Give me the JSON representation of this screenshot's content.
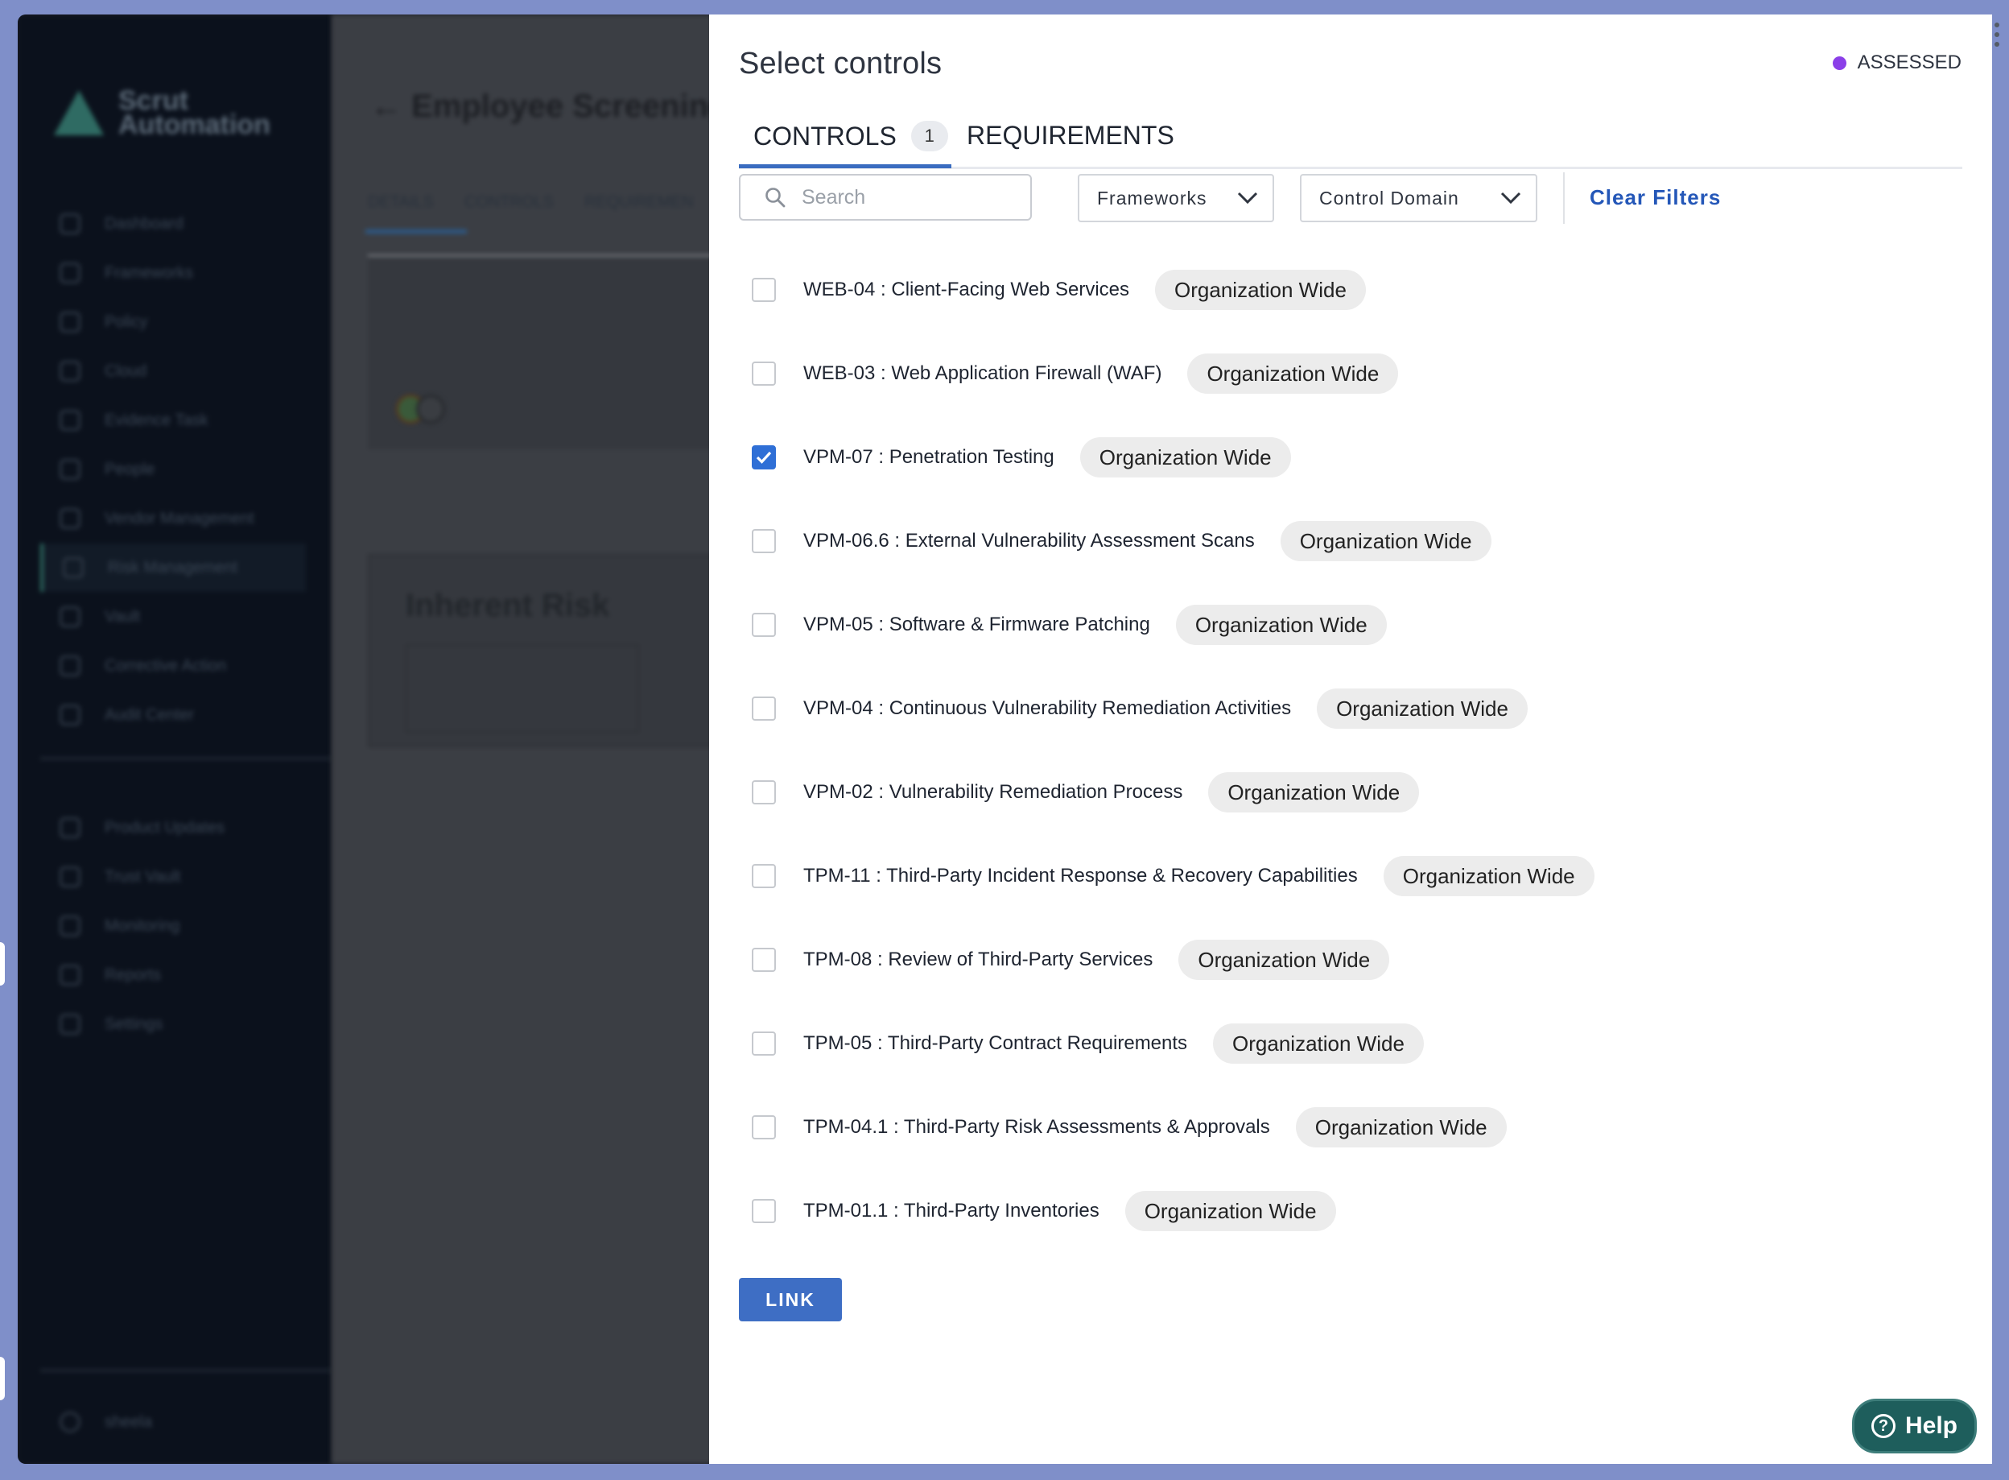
{
  "background": {
    "logo_text": "Scrut Automation",
    "sidebar_items": [
      "Dashboard",
      "Frameworks",
      "Policy",
      "Cloud",
      "Evidence Task",
      "People",
      "Vendor Management",
      "Risk Management",
      "Vault",
      "Corrective Action",
      "Audit Center"
    ],
    "sidebar_items_bottom": [
      "Product Updates",
      "Trust Vault",
      "Monitoring",
      "Reports",
      "Settings"
    ],
    "user_name": "sheela",
    "page_heading": "← Employee Screening - t",
    "tabs": [
      "DETAILS",
      "CONTROLS",
      "REQUIREMEN"
    ],
    "inherent_risk_title": "Inherent Risk"
  },
  "modal": {
    "title": "Select controls",
    "status": {
      "label": "ASSESSED",
      "color": "#8b3fe8"
    },
    "tabs": [
      {
        "label": "CONTROLS",
        "count": "1",
        "active": true
      },
      {
        "label": "REQUIREMENTS",
        "active": false
      }
    ],
    "search": {
      "placeholder": "Search",
      "value": ""
    },
    "filters": {
      "frameworks": "Frameworks",
      "control_domain": "Control Domain",
      "clear": "Clear Filters"
    },
    "controls": [
      {
        "label": "WEB-04 : Client-Facing Web Services",
        "scope": "Organization Wide",
        "checked": false
      },
      {
        "label": "WEB-03 : Web Application Firewall (WAF)",
        "scope": "Organization Wide",
        "checked": false
      },
      {
        "label": "VPM-07 : Penetration Testing",
        "scope": "Organization Wide",
        "checked": true
      },
      {
        "label": "VPM-06.6 : External Vulnerability Assessment Scans",
        "scope": "Organization Wide",
        "checked": false
      },
      {
        "label": "VPM-05 : Software & Firmware Patching",
        "scope": "Organization Wide",
        "checked": false
      },
      {
        "label": "VPM-04 : Continuous Vulnerability Remediation Activities",
        "scope": "Organization Wide",
        "checked": false
      },
      {
        "label": "VPM-02 : Vulnerability Remediation Process",
        "scope": "Organization Wide",
        "checked": false
      },
      {
        "label": "TPM-11 : Third-Party Incident Response & Recovery Capabilities",
        "scope": "Organization Wide",
        "checked": false
      },
      {
        "label": "TPM-08 : Review of Third-Party Services",
        "scope": "Organization Wide",
        "checked": false
      },
      {
        "label": "TPM-05 : Third-Party Contract Requirements",
        "scope": "Organization Wide",
        "checked": false
      },
      {
        "label": "TPM-04.1 : Third-Party Risk Assessments & Approvals",
        "scope": "Organization Wide",
        "checked": false
      },
      {
        "label": "TPM-01.1 : Third-Party Inventories",
        "scope": "Organization Wide",
        "checked": false
      }
    ],
    "link_button": "LINK"
  },
  "help_button": "Help",
  "colors": {
    "accent": "#3e6ec4",
    "help": "#1e5e5c",
    "checked": "#2f6fd6"
  }
}
